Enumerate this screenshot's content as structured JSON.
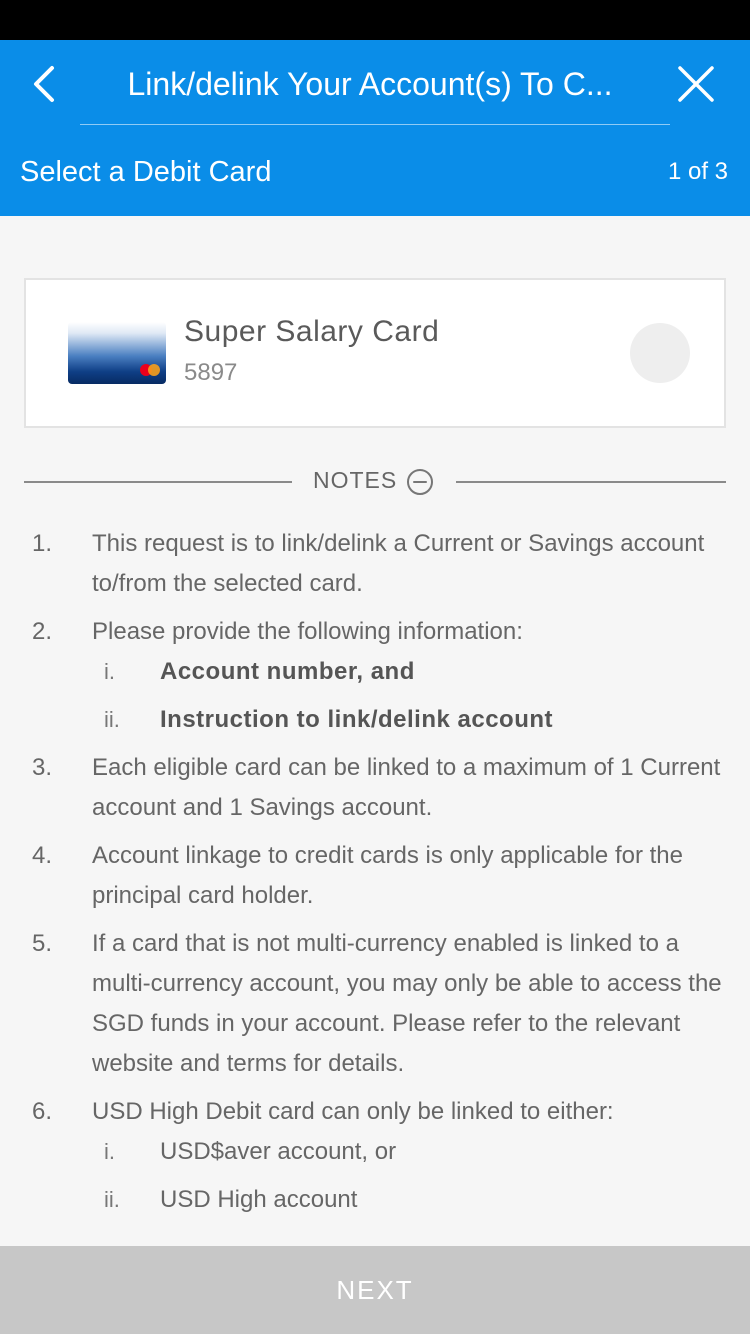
{
  "header": {
    "title": "Link/delink Your Account(s) To C...",
    "subheader": "Select a Debit Card",
    "step": "1 of 3"
  },
  "card": {
    "name": "Super Salary Card",
    "number": "5897"
  },
  "notes": {
    "label": "NOTES",
    "items": [
      {
        "num": "1.",
        "text": "This request is to link/delink a Current or Savings account to/from the selected card."
      },
      {
        "num": "2.",
        "text": "Please provide the following information:",
        "sub": [
          {
            "num": "i.",
            "text": "Account number, and"
          },
          {
            "num": "ii.",
            "text": "Instruction to link/delink account"
          }
        ]
      },
      {
        "num": "3.",
        "text": "Each eligible card can be linked to a maximum of 1 Current account and 1 Savings account."
      },
      {
        "num": "4.",
        "text": "Account linkage to credit cards is only applicable for the principal card holder."
      },
      {
        "num": "5.",
        "text": "If a card that is not multi-currency enabled is linked to a multi-currency account, you may only be able to access the SGD funds in your account. Please refer to the relevant website and terms for details."
      },
      {
        "num": "6.",
        "text": "USD High Debit card can only be linked to either:",
        "sub": [
          {
            "num": "i.",
            "text": "USD$aver account, or"
          },
          {
            "num": "ii.",
            "text": "USD High account"
          }
        ]
      }
    ]
  },
  "footer": {
    "next_label": "NEXT"
  },
  "colors": {
    "header_bg": "#0a8de8",
    "footer_bg": "#c7c7c7"
  },
  "icons": {
    "back": "chevron-left-icon",
    "close": "close-icon",
    "notes_toggle": "minus-circle-icon"
  }
}
